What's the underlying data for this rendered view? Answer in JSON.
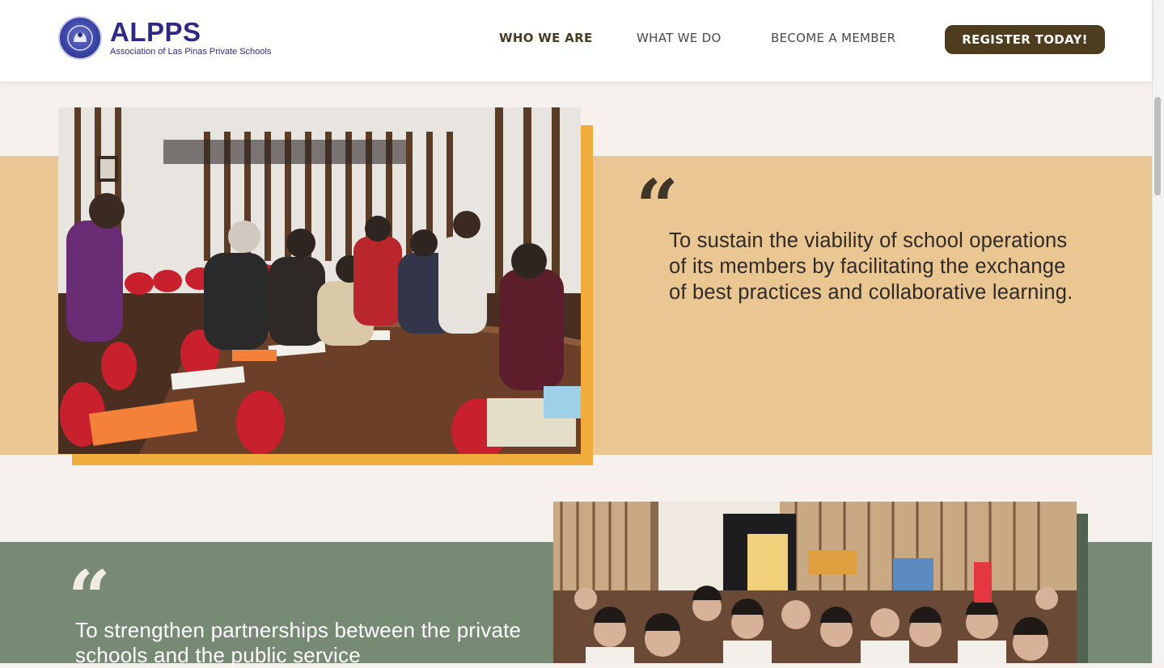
{
  "header": {
    "logo_title": "ALPPS",
    "logo_subtitle": "Association of Las Pinas Private Schools",
    "nav": [
      {
        "label": "WHO WE ARE",
        "active": true
      },
      {
        "label": "WHAT WE DO",
        "active": false
      },
      {
        "label": "BECOME A MEMBER",
        "active": false
      }
    ],
    "cta_label": "REGISTER TODAY!"
  },
  "sections": [
    {
      "quote_mark": "“",
      "text": "To sustain the viability of school operations of its members by facilitating the exchange of best practices and collaborative learning.",
      "photo": "meeting-room-photo",
      "band_color": "#e9c692",
      "frame_color": "#f1ac3e"
    },
    {
      "quote_mark": "“",
      "text": "To strengthen partnerships between the private schools and the public service",
      "photo": "general-assembly-photo",
      "band_color": "#778a74",
      "frame_color": "#4f6350"
    }
  ],
  "colors": {
    "brand": "#2f2a84",
    "cta": "#4e3c1f",
    "page_bg": "#f6f1ed"
  }
}
